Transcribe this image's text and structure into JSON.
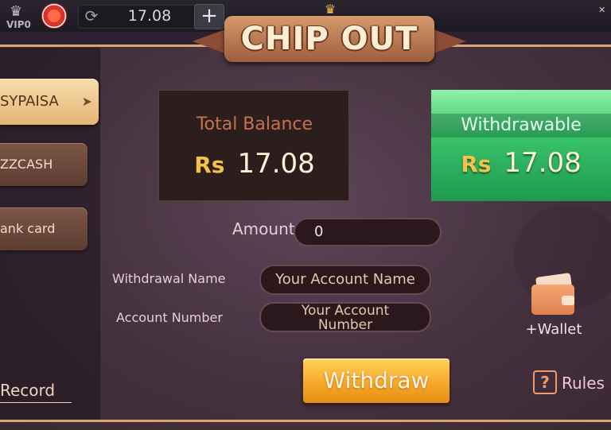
{
  "topbar": {
    "vip_label": "VIP0",
    "coin_balance": "17.08",
    "plus_label": "+"
  },
  "title": "CHIP OUT",
  "sidebar": {
    "items": [
      {
        "label": "SYPAISA",
        "active": true
      },
      {
        "label": "ZZCASH",
        "active": false
      },
      {
        "label": "ank card",
        "active": false
      }
    ],
    "record_label": "Record"
  },
  "balances": {
    "total_label": "Total Balance",
    "total_currency": "Rs",
    "total_amount": "17.08",
    "withdrawable_label": "Withdrawable",
    "withdrawable_currency": "Rs",
    "withdrawable_amount": "17.08"
  },
  "form": {
    "amount_label": "Amount",
    "amount_value": "0",
    "withdrawal_name_label": "Withdrawal Name",
    "withdrawal_name_placeholder": "Your Account Name",
    "account_number_label": "Account Number",
    "account_number_placeholder_line1": "Your Account",
    "account_number_placeholder_line2": "Number"
  },
  "actions": {
    "withdraw_label": "Withdraw",
    "wallet_label": "+Wallet",
    "rules_label": "Rules",
    "rules_icon_glyph": "?"
  },
  "colors": {
    "accent_gold": "#f7a92a",
    "withdrawable_green": "#39c56a",
    "panel_bg": "#46323f"
  }
}
